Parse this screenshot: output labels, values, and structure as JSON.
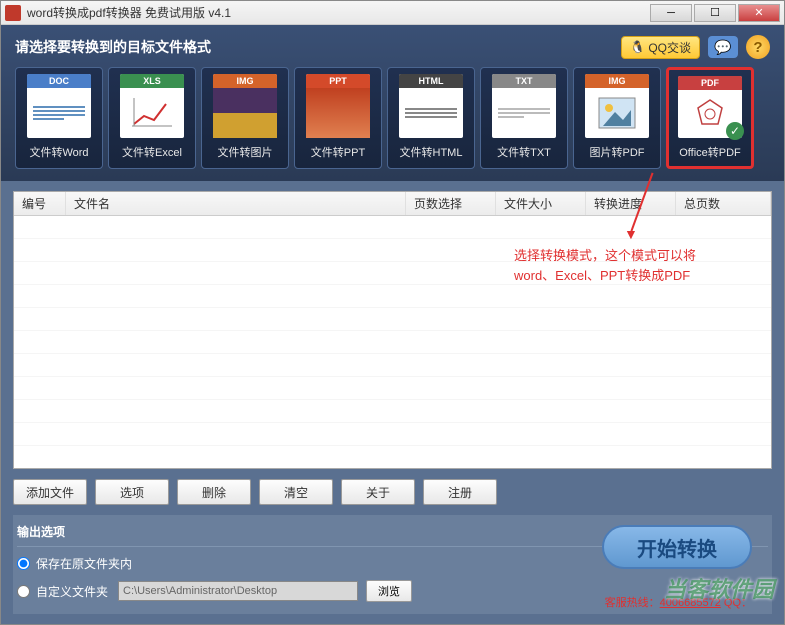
{
  "titlebar": {
    "text": "word转换成pdf转换器 免费试用版 v4.1"
  },
  "format_bar": {
    "title": "请选择要转换到的目标文件格式",
    "qq_label": "QQ交谈",
    "help_label": "?"
  },
  "tiles": [
    {
      "tab": "DOC",
      "label": "文件转Word",
      "tabClass": "doc-tab"
    },
    {
      "tab": "XLS",
      "label": "文件转Excel",
      "tabClass": "xls-tab"
    },
    {
      "tab": "IMG",
      "label": "文件转图片",
      "tabClass": "img-tab"
    },
    {
      "tab": "PPT",
      "label": "文件转PPT",
      "tabClass": "ppt-tab"
    },
    {
      "tab": "HTML",
      "label": "文件转HTML",
      "tabClass": "html-tab"
    },
    {
      "tab": "TXT",
      "label": "文件转TXT",
      "tabClass": "txt-tab"
    },
    {
      "tab": "IMG",
      "label": "图片转PDF",
      "tabClass": "img-tab"
    },
    {
      "tab": "PDF",
      "label": "Office转PDF",
      "tabClass": "pdf-tab",
      "selected": true
    }
  ],
  "table": {
    "headers": {
      "no": "编号",
      "name": "文件名",
      "pages": "页数选择",
      "size": "文件大小",
      "progress": "转换进度",
      "total": "总页数"
    }
  },
  "annotation": {
    "line1": "选择转换模式，这个模式可以将",
    "line2": "word、Excel、PPT转换成PDF"
  },
  "buttons": {
    "add": "添加文件",
    "select": "选项",
    "delete": "删除",
    "clear": "清空",
    "about": "关于",
    "register": "注册"
  },
  "output": {
    "title": "输出选项",
    "keep_original": "保存在原文件夹内",
    "custom_folder": "自定义文件夹",
    "path": "C:\\Users\\Administrator\\Desktop",
    "browse": "浏览",
    "start": "开始转换"
  },
  "footer": {
    "hotline_label": "客服热线：",
    "phone": "4006685572",
    "qq_label": " QQ："
  },
  "watermark": "当客软件园"
}
